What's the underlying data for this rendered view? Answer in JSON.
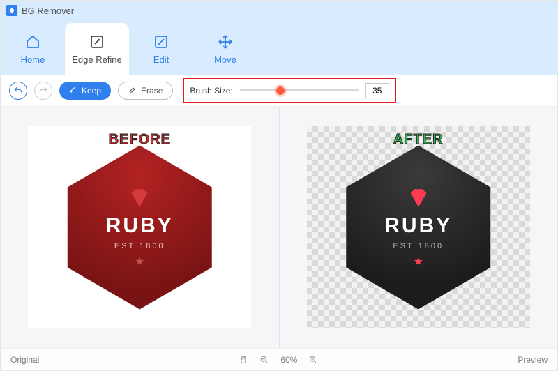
{
  "title": "BG Remover",
  "tabs": [
    {
      "label": "Home"
    },
    {
      "label": "Edge Refine"
    },
    {
      "label": "Edit"
    },
    {
      "label": "Move"
    }
  ],
  "active_tab_index": 1,
  "toolbar": {
    "keep_label": "Keep",
    "erase_label": "Erase"
  },
  "brush": {
    "label": "Brush Size:",
    "value": "35",
    "min": 1,
    "max": 100
  },
  "panels": {
    "before_label": "BEFORE",
    "after_label": "AFTER",
    "badge_title": "RUBY",
    "badge_est": "EST 1800"
  },
  "footer": {
    "original": "Original",
    "zoom_text": "60%",
    "preview": "Preview"
  }
}
